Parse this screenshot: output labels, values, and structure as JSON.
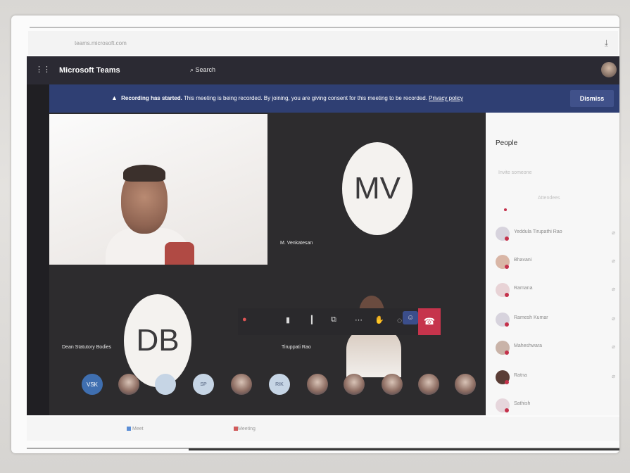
{
  "browser": {
    "url": "teams.microsoft.com",
    "download_icon": "download-icon"
  },
  "titlebar": {
    "app_name": "Microsoft Teams",
    "search_placeholder": "Search"
  },
  "banner": {
    "title": "Recording has started.",
    "message": "This meeting is being recorded. By joining, you are giving consent for this meeting to be recorded.",
    "link": "Privacy policy",
    "dismiss": "Dismiss"
  },
  "tiles": [
    {
      "initials": "MV",
      "name": "M. Venkatesan"
    },
    {
      "initials": "DB",
      "name": "Dean Statutory Bodies"
    },
    {
      "name": "Tiruppati Rao"
    }
  ],
  "people_panel": {
    "title": "People",
    "search": "Invite someone",
    "attendees_label": "Attendees",
    "rows": [
      "Yeddula Tirupathi Rao",
      "Bhavani",
      "Ramana",
      "Ramesh Kumar",
      "Maheshwara",
      "Ratna",
      "Sathish"
    ]
  },
  "strip": [
    "VSK",
    "",
    "",
    "SP",
    "",
    "RIK",
    "",
    "",
    "",
    "",
    ""
  ],
  "taskbar": {
    "item1": "Meet",
    "item2": "Meeting"
  },
  "colors": {
    "banner": "#2f3f73",
    "hangup": "#c6344c",
    "accent": "#3b4e8b"
  }
}
